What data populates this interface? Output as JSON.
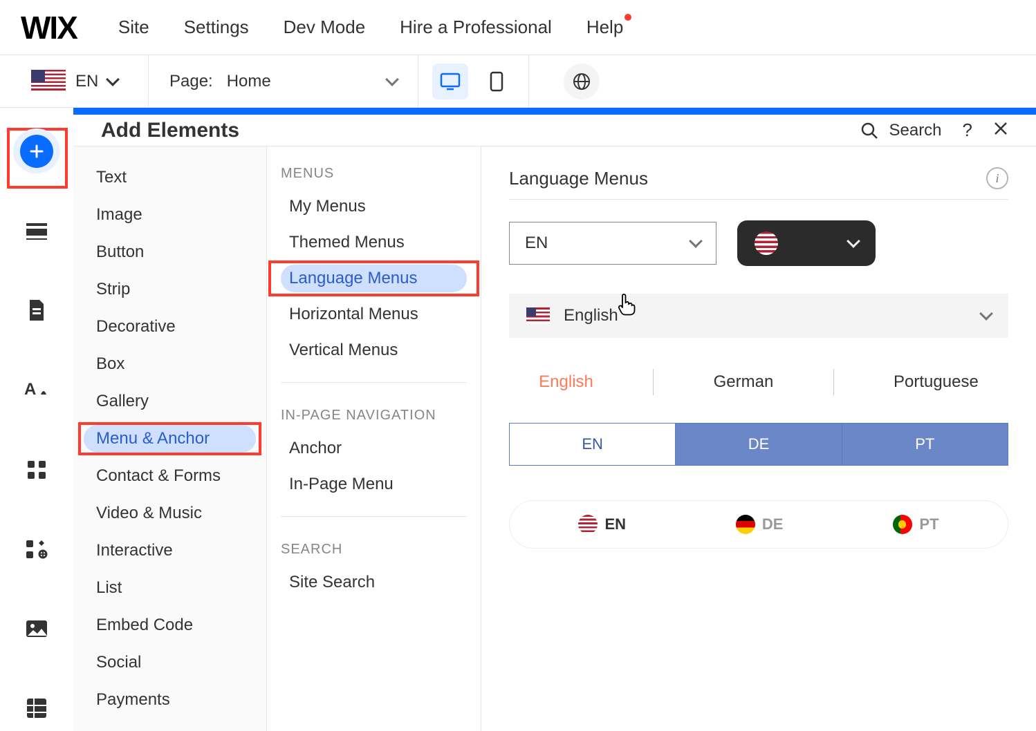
{
  "logo": "WIX",
  "topmenu": {
    "site": "Site",
    "settings": "Settings",
    "devmode": "Dev Mode",
    "hire": "Hire a Professional",
    "help": "Help"
  },
  "subbar": {
    "lang_code": "EN",
    "page_label": "Page:",
    "page_value": "Home"
  },
  "panel": {
    "title": "Add Elements",
    "search": "Search"
  },
  "categories": {
    "text": "Text",
    "image": "Image",
    "button": "Button",
    "strip": "Strip",
    "decorative": "Decorative",
    "box": "Box",
    "gallery": "Gallery",
    "menu_anchor": "Menu & Anchor",
    "contact_forms": "Contact & Forms",
    "video_music": "Video & Music",
    "interactive": "Interactive",
    "list": "List",
    "embed_code": "Embed Code",
    "social": "Social",
    "payments": "Payments"
  },
  "subcats": {
    "heading_menus": "MENUS",
    "my_menus": "My Menus",
    "themed_menus": "Themed Menus",
    "language_menus": "Language Menus",
    "horizontal_menus": "Horizontal Menus",
    "vertical_menus": "Vertical Menus",
    "heading_inpage": "IN-PAGE NAVIGATION",
    "anchor": "Anchor",
    "inpage_menu": "In-Page Menu",
    "heading_search": "SEARCH",
    "site_search": "Site Search"
  },
  "preview": {
    "title": "Language Menus",
    "preset_en_label": "EN",
    "preset_english_label": "English",
    "text_row": {
      "en": "English",
      "de": "German",
      "pt": "Portuguese"
    },
    "tabs": {
      "en": "EN",
      "de": "DE",
      "pt": "PT"
    },
    "pills": {
      "en": "EN",
      "de": "DE",
      "pt": "PT"
    }
  }
}
